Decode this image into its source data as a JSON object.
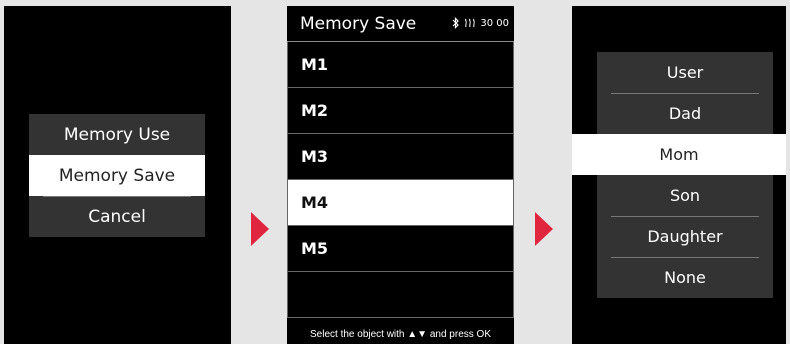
{
  "screen1": {
    "menu": [
      {
        "label": "Memory Use"
      },
      {
        "label": "Memory Save"
      },
      {
        "label": "Cancel"
      }
    ],
    "selected_index": 1
  },
  "screen2": {
    "title": "Memory Save",
    "status": {
      "bluetooth_icon": "bluetooth-icon",
      "heat_icon": "heat-icon",
      "value": "30 00"
    },
    "slots": [
      {
        "label": "M1"
      },
      {
        "label": "M2"
      },
      {
        "label": "M3"
      },
      {
        "label": "M4"
      },
      {
        "label": "M5"
      }
    ],
    "selected_index": 3,
    "footer": "Select the object with ▲▼ and press OK"
  },
  "screen3": {
    "menu": [
      {
        "label": "User"
      },
      {
        "label": "Dad"
      },
      {
        "label": "Mom"
      },
      {
        "label": "Son"
      },
      {
        "label": "Daughter"
      },
      {
        "label": "None"
      }
    ],
    "selected_index": 2
  },
  "colors": {
    "arrow": "#e0263e",
    "menu_bg": "#333333",
    "screen_bg": "#000000",
    "page_bg": "#e5e5e5"
  }
}
